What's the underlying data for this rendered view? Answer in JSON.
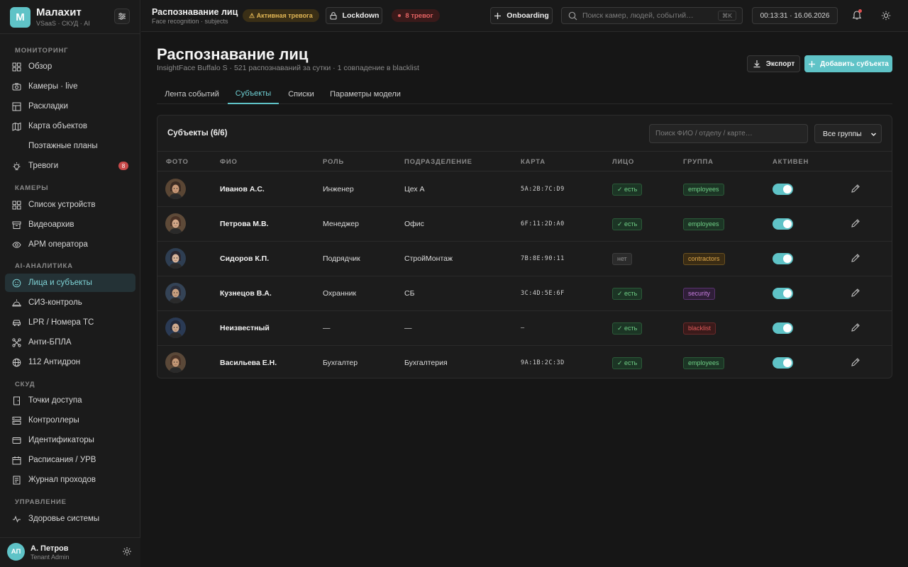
{
  "brand": {
    "logo_letter": "M",
    "name": "Малахит",
    "sub": "VSaaS · СКУД · AI"
  },
  "nav": {
    "sections": [
      {
        "label": "МОНИТОРИНГ"
      },
      {
        "label": "КАМЕРЫ"
      },
      {
        "label": "AI-АНАЛИТИКА"
      },
      {
        "label": "СКУД"
      },
      {
        "label": "УПРАВЛЕНИЕ"
      }
    ],
    "items": [
      {
        "label": "Обзор",
        "icon": "grid-icon"
      },
      {
        "label": "Камеры · live",
        "icon": "camera-icon"
      },
      {
        "label": "Раскладки",
        "icon": "layout-icon"
      },
      {
        "label": "Карта объектов",
        "icon": "map-icon"
      },
      {
        "label": "Поэтажные планы",
        "icon": ""
      },
      {
        "label": "Тревоги",
        "icon": "bulb-icon",
        "badge": "8"
      },
      {
        "label": "Список устройств",
        "icon": "grid-icon"
      },
      {
        "label": "Видеоархив",
        "icon": "archive-icon"
      },
      {
        "label": "АРМ оператора",
        "icon": "eye-icon"
      },
      {
        "label": "Лица и субъекты",
        "icon": "face-icon"
      },
      {
        "label": "СИЗ-контроль",
        "icon": "helmet-icon"
      },
      {
        "label": "LPR / Номера ТС",
        "icon": "car-icon"
      },
      {
        "label": "Анти-БПЛА",
        "icon": "drone-icon"
      },
      {
        "label": "112 Антидрон",
        "icon": "globe-icon"
      },
      {
        "label": "Точки доступа",
        "icon": "door-icon"
      },
      {
        "label": "Контроллеры",
        "icon": "server-icon"
      },
      {
        "label": "Идентификаторы",
        "icon": "card-icon"
      },
      {
        "label": "Расписания / УРВ",
        "icon": "calendar-icon"
      },
      {
        "label": "Журнал проходов",
        "icon": "journal-icon"
      },
      {
        "label": "Здоровье системы",
        "icon": "pulse-icon"
      }
    ]
  },
  "user": {
    "initials": "АП",
    "name": "А. Петров",
    "role": "Tenant Admin"
  },
  "topbar": {
    "title": "Распознавание лиц",
    "subtitle": "Face recognition · subjects",
    "alert_pill": "⚠ Активная тревога",
    "lockdown": "Lockdown",
    "alarms": "8 тревог",
    "onboarding": "Onboarding",
    "search_placeholder": "Поиск камер, людей, событий…",
    "search_shortcut": "⌘K",
    "clock": "00:13:31 · 16.06.2026"
  },
  "page": {
    "title": "Распознавание лиц",
    "subtitle": "InsightFace Buffalo S · 521 распознаваний за сутки · 1 совпадение в blacklist",
    "export": "Экспорт",
    "add": "Добавить субъекта"
  },
  "tabs": [
    {
      "label": "Лента событий"
    },
    {
      "label": "Субъекты"
    },
    {
      "label": "Списки"
    },
    {
      "label": "Параметры модели"
    }
  ],
  "table": {
    "title": "Субъекты (6/6)",
    "search_placeholder": "Поиск ФИО / отделу / карте…",
    "group_filter": "Все группы",
    "columns": [
      "ФОТО",
      "ФИО",
      "РОЛЬ",
      "ПОДРАЗДЕЛЕНИЕ",
      "КАРТА",
      "ЛИЦО",
      "ГРУППА",
      "АКТИВЕН"
    ],
    "rows": [
      {
        "name": "Иванов А.С.",
        "role": "Инженер",
        "dept": "Цех А",
        "card": "5A:2B:7C:D9",
        "face": "✓ есть",
        "group": "employees",
        "active": true
      },
      {
        "name": "Петрова М.В.",
        "role": "Менеджер",
        "dept": "Офис",
        "card": "6F:11:2D:A0",
        "face": "✓ есть",
        "group": "employees",
        "active": true
      },
      {
        "name": "Сидоров К.П.",
        "role": "Подрядчик",
        "dept": "СтройМонтаж",
        "card": "7B:8E:90:11",
        "face": "нет",
        "group": "contractors",
        "active": true
      },
      {
        "name": "Кузнецов В.А.",
        "role": "Охранник",
        "dept": "СБ",
        "card": "3C:4D:5E:6F",
        "face": "✓ есть",
        "group": "security",
        "active": true
      },
      {
        "name": "Неизвестный",
        "role": "—",
        "dept": "—",
        "card": "—",
        "face": "✓ есть",
        "group": "blacklist",
        "active": true
      },
      {
        "name": "Васильева Е.Н.",
        "role": "Бухгалтер",
        "dept": "Бухгалтерия",
        "card": "9A:1B:2C:3D",
        "face": "✓ есть",
        "group": "employees",
        "active": true
      }
    ]
  },
  "colors": {
    "accent": "#5fc3c7",
    "employees": "#6fcf86",
    "contractors": "#e0a94a",
    "security": "#c77ee0",
    "blacklist": "#e05a5a"
  }
}
